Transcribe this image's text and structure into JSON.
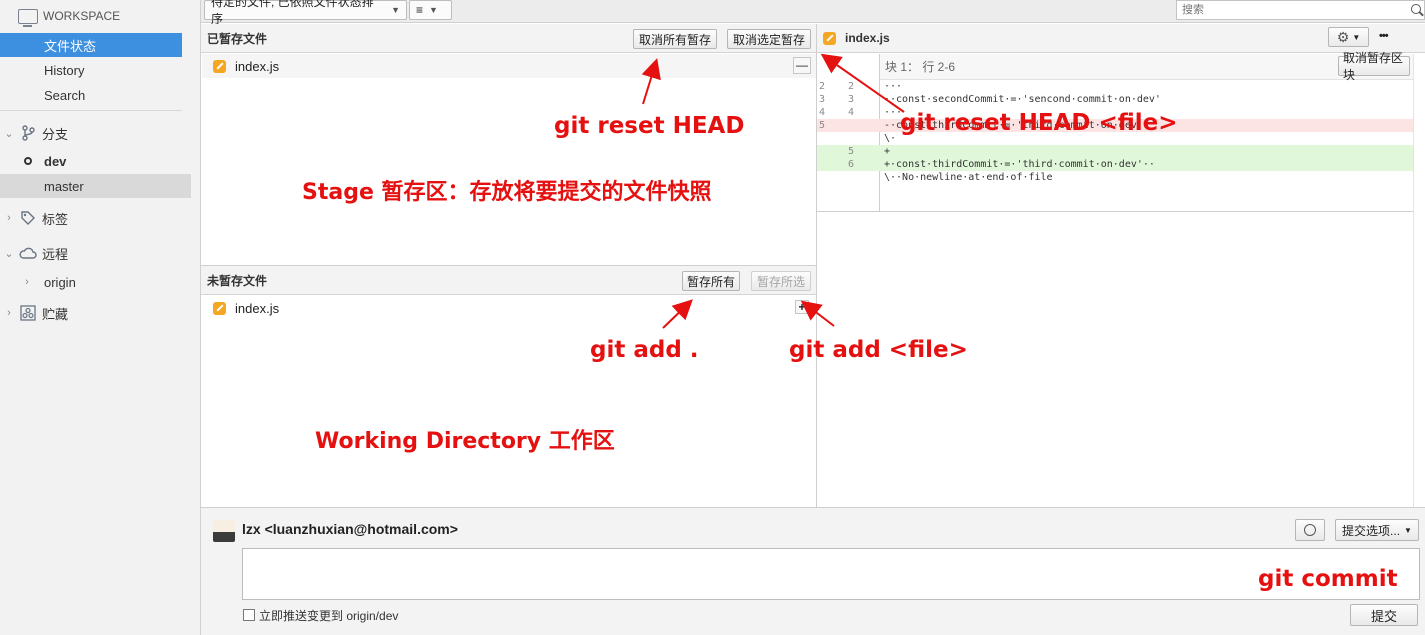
{
  "sidebar": {
    "workspace_label": "WORKSPACE",
    "items": [
      {
        "label": "文件状态"
      },
      {
        "label": "History"
      },
      {
        "label": "Search"
      }
    ],
    "branches_label": "分支",
    "branches": [
      "dev",
      "master"
    ],
    "tags_label": "标签",
    "remotes_label": "远程",
    "remotes": [
      "origin"
    ],
    "stash_label": "贮藏"
  },
  "toolbar": {
    "sort_select": "待定的文件, 已依照文件状态排序",
    "view_select": "≡",
    "search_placeholder": "搜索"
  },
  "staged": {
    "title": "已暂存文件",
    "unstage_all": "取消所有暂存",
    "unstage_selected": "取消选定暂存",
    "files": [
      "index.js"
    ],
    "row_action": "—"
  },
  "unstaged": {
    "title": "未暂存文件",
    "stage_all": "暂存所有",
    "stage_selected": "暂存所选",
    "files": [
      "index.js"
    ],
    "row_action": "+"
  },
  "diff": {
    "file_name": "index.js",
    "more": "•••",
    "hunk_header": "块 1： 行 2-6",
    "unstage_hunk": "取消暂存区块",
    "lines": [
      {
        "old": "2",
        "new": "2",
        "text": "···",
        "type": "ctx"
      },
      {
        "old": "3",
        "new": "3",
        "text": "··const·secondCommit·=·'sencond·commit·on·dev'",
        "type": "ctx"
      },
      {
        "old": "4",
        "new": "4",
        "text": "···",
        "type": "ctx"
      },
      {
        "old": "5",
        "new": "",
        "text": "-·const·thirdCommit·=·'third·commit·on·dev'",
        "type": "del"
      },
      {
        "old": "",
        "new": "",
        "text": "\\·",
        "type": "ctx"
      },
      {
        "old": "",
        "new": "5",
        "text": "+",
        "type": "add"
      },
      {
        "old": "",
        "new": "6",
        "text": "+·const·thirdCommit·=·'third·commit·on·dev'··",
        "type": "add"
      },
      {
        "old": "",
        "new": "",
        "text": "\\··No·newline·at·end·of·file",
        "type": "ctx"
      }
    ]
  },
  "annotations": {
    "reset_head": "git reset HEAD",
    "reset_head_file": "git reset HEAD <file>",
    "stage_desc": "Stage 暂存区：存放将要提交的文件快照",
    "add_all": "git add .",
    "add_file": "git add <file>",
    "working_dir": "Working Directory 工作区",
    "commit": "git commit"
  },
  "commit": {
    "author": "lzx <luanzhuxian@hotmail.com>",
    "options": "提交选项...",
    "push_label": "立即推送变更到 origin/dev",
    "submit": "提交"
  },
  "colors": {
    "accent": "#3d8fe0",
    "annotation": "#e51010",
    "js_icon": "#f5a623",
    "diff_add": "#e0f7d9",
    "diff_del": "#fde4e4"
  }
}
